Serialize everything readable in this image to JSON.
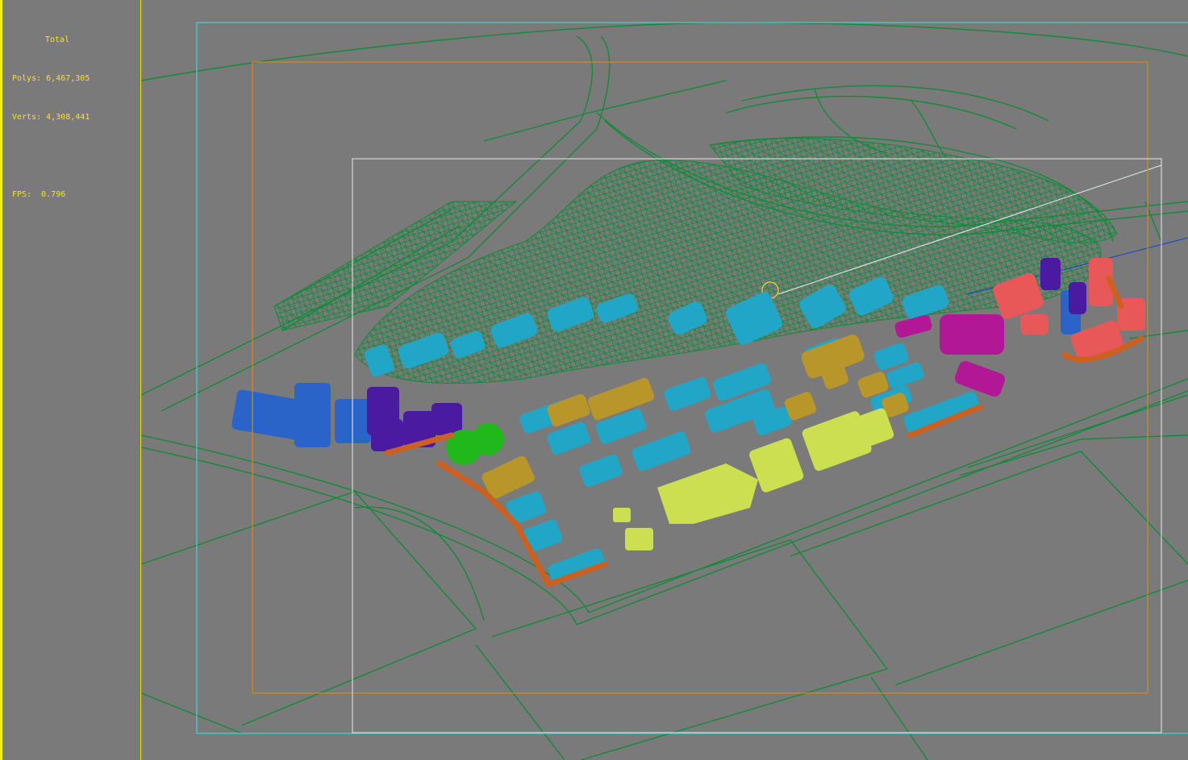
{
  "stats": {
    "total_label": "Total",
    "polys_label": "Polys:",
    "polys_value": "6,467,305",
    "verts_label": "Verts:",
    "verts_value": "4,308,441",
    "fps_label": "FPS:",
    "fps_value": "0.796"
  },
  "colors": {
    "background": "#7a7a7a",
    "wireframe": "#138a3a",
    "safe_frame_outer": "#3fd6d6",
    "safe_frame_action": "#d08a1a",
    "safe_frame_title": "#d8d8d8",
    "stats_text": "#ffdf2e",
    "viewport_border": "#f2f20a"
  }
}
